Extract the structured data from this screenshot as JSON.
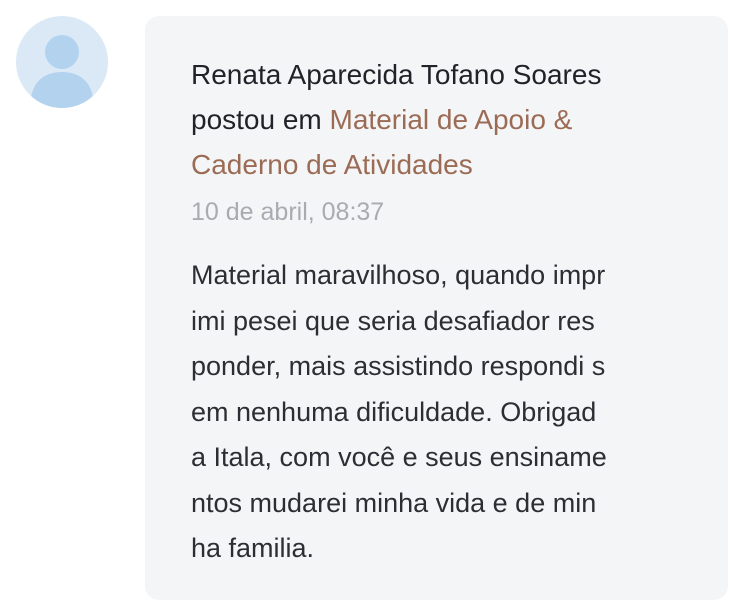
{
  "post": {
    "author": "Renata Aparecida Tofano Soares",
    "action": "postou em",
    "group_link_line1": "Material de Apoio &",
    "group_link_line2": "Caderno de Atividades",
    "timestamp": "10 de abril, 08:37",
    "content_lines": [
      "Material maravilhoso, quando impr",
      "imi pesei que seria desafiador res",
      "ponder, mais assistindo respondi s",
      "em nenhuma dificuldade. Obrigad",
      "a Itala, com você e seus ensiname",
      "ntos mudarei minha vida e de min",
      "ha familia."
    ]
  },
  "avatar": {
    "icon": "user-silhouette-icon",
    "bg_color": "#dbe9f6",
    "fg_color": "#b3d2ee"
  },
  "colors": {
    "link": "#9c6b55",
    "timestamp": "#a8abb0",
    "card_bg": "#f4f5f7"
  }
}
